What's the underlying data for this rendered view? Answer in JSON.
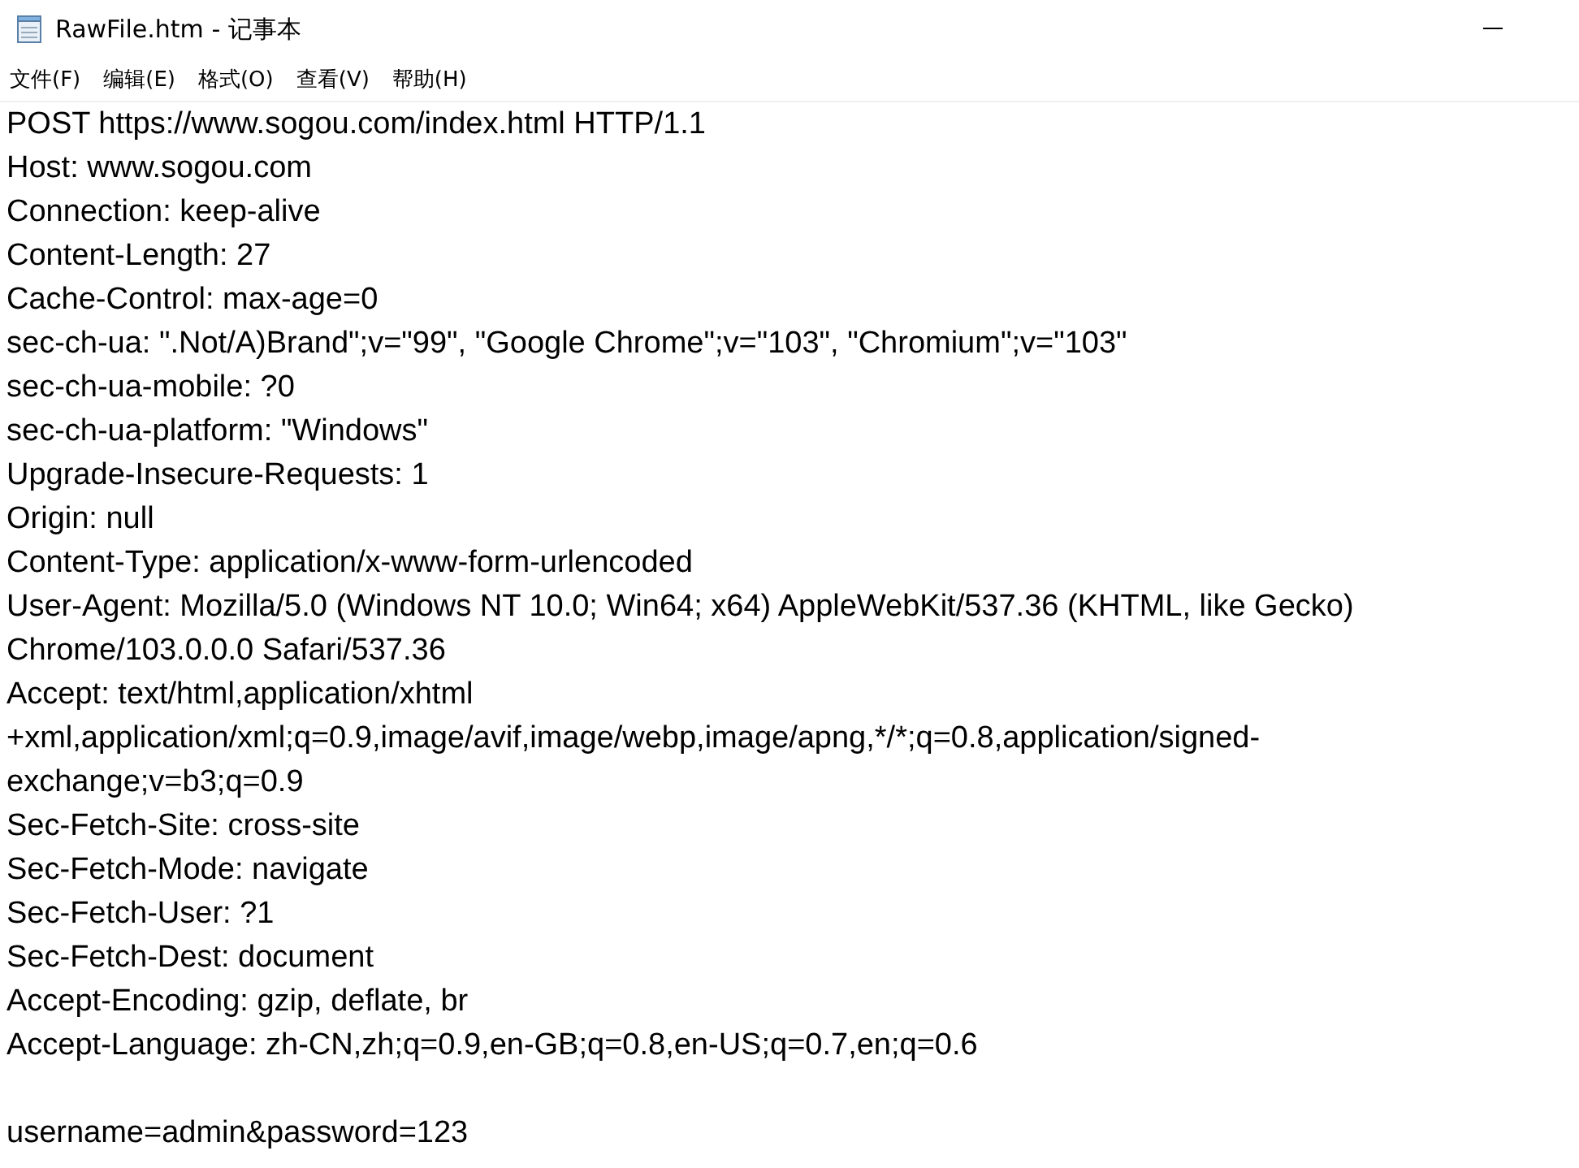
{
  "window": {
    "title": "RawFile.htm - 记事本"
  },
  "menu": [
    {
      "label": "文件(F)"
    },
    {
      "label": "编辑(E)"
    },
    {
      "label": "格式(O)"
    },
    {
      "label": "查看(V)"
    },
    {
      "label": "帮助(H)"
    }
  ],
  "request_headers": [
    "POST https://www.sogou.com/index.html HTTP/1.1",
    "Host: www.sogou.com",
    "Connection: keep-alive",
    "Content-Length: 27",
    "Cache-Control: max-age=0",
    "sec-ch-ua: \".Not/A)Brand\";v=\"99\", \"Google Chrome\";v=\"103\", \"Chromium\";v=\"103\"",
    "sec-ch-ua-mobile: ?0",
    "sec-ch-ua-platform: \"Windows\"",
    "Upgrade-Insecure-Requests: 1",
    "Origin: null",
    "Content-Type: application/x-www-form-urlencoded",
    "User-Agent: Mozilla/5.0 (Windows NT 10.0; Win64; x64) AppleWebKit/537.36 (KHTML, like Gecko)",
    "Chrome/103.0.0.0 Safari/537.36",
    "Accept: text/html,application/xhtml",
    "+xml,application/xml;q=0.9,image/avif,image/webp,image/apng,*/*;q=0.8,application/signed-",
    "exchange;v=b3;q=0.9",
    "Sec-Fetch-Site: cross-site",
    "Sec-Fetch-Mode: navigate",
    "Sec-Fetch-User: ?1",
    "Sec-Fetch-Dest: document",
    "Accept-Encoding: gzip, deflate, br",
    "Accept-Language: zh-CN,zh;q=0.9,en-GB;q=0.8,en-US;q=0.7,en;q=0.6"
  ],
  "request_body": "username=admin&password=123"
}
